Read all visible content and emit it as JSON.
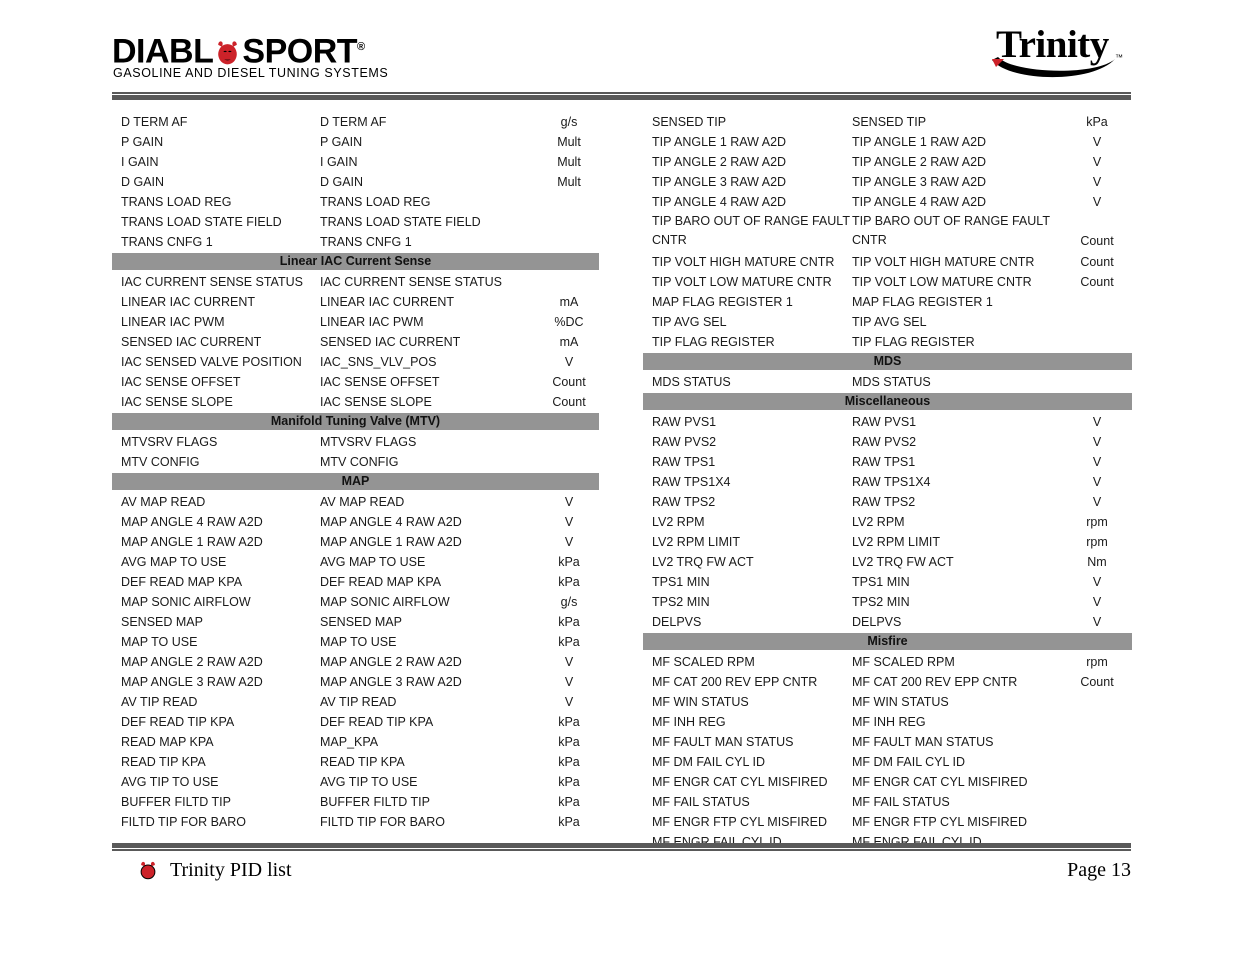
{
  "header": {
    "brand_logo": {
      "wordmark_pre": "DIABL",
      "wordmark_post": "SPORT",
      "registered_mark": "®",
      "tagline": "GASOLINE AND DIESEL TUNING SYSTEMS"
    },
    "product_logo": {
      "name": "Trinity",
      "trademark": "™"
    }
  },
  "footer": {
    "title": "Trinity PID list",
    "page_label": "Page 13"
  },
  "colors": {
    "section_band": "#949494",
    "rule": "#595959",
    "devil_red": "#cc2229",
    "text": "#1a1a1a"
  },
  "left_column": [
    {
      "type": "row",
      "name": "D TERM AF",
      "alias": "D TERM AF",
      "unit": "g/s"
    },
    {
      "type": "row",
      "name": "P GAIN",
      "alias": "P GAIN",
      "unit": "Mult"
    },
    {
      "type": "row",
      "name": "I GAIN",
      "alias": "I GAIN",
      "unit": "Mult"
    },
    {
      "type": "row",
      "name": "D GAIN",
      "alias": "D GAIN",
      "unit": "Mult"
    },
    {
      "type": "row",
      "name": "TRANS LOAD REG",
      "alias": "TRANS LOAD REG",
      "unit": ""
    },
    {
      "type": "row",
      "name": "TRANS LOAD STATE FIELD",
      "alias": "TRANS LOAD STATE FIELD",
      "unit": ""
    },
    {
      "type": "row",
      "name": "TRANS CNFG 1",
      "alias": "TRANS CNFG 1",
      "unit": ""
    },
    {
      "type": "section",
      "title": "Linear IAC Current Sense"
    },
    {
      "type": "row",
      "name": "IAC CURRENT SENSE STATUS",
      "alias": "IAC CURRENT SENSE STATUS",
      "unit": ""
    },
    {
      "type": "row",
      "name": "LINEAR IAC CURRENT",
      "alias": "LINEAR IAC CURRENT",
      "unit": "mA"
    },
    {
      "type": "row",
      "name": "LINEAR IAC PWM",
      "alias": "LINEAR IAC PWM",
      "unit": "%DC"
    },
    {
      "type": "row",
      "name": "SENSED IAC CURRENT",
      "alias": "SENSED IAC CURRENT",
      "unit": "mA"
    },
    {
      "type": "row",
      "name": "IAC SENSED VALVE POSITION",
      "alias": "IAC_SNS_VLV_POS",
      "unit": "V"
    },
    {
      "type": "row",
      "name": "IAC SENSE OFFSET",
      "alias": "IAC SENSE OFFSET",
      "unit": "Count"
    },
    {
      "type": "row",
      "name": "IAC SENSE SLOPE",
      "alias": "IAC SENSE SLOPE",
      "unit": "Count"
    },
    {
      "type": "section",
      "title": "Manifold Tuning Valve (MTV)"
    },
    {
      "type": "row",
      "name": "MTVSRV FLAGS",
      "alias": "MTVSRV FLAGS",
      "unit": ""
    },
    {
      "type": "row",
      "name": "MTV CONFIG",
      "alias": "MTV CONFIG",
      "unit": ""
    },
    {
      "type": "section",
      "title": "MAP"
    },
    {
      "type": "row",
      "name": "AV MAP READ",
      "alias": "AV MAP READ",
      "unit": "V"
    },
    {
      "type": "row",
      "name": "MAP ANGLE 4 RAW A2D",
      "alias": "MAP ANGLE 4 RAW A2D",
      "unit": "V"
    },
    {
      "type": "row",
      "name": "MAP ANGLE 1 RAW A2D",
      "alias": "MAP ANGLE 1 RAW A2D",
      "unit": "V"
    },
    {
      "type": "row",
      "name": "AVG MAP TO USE",
      "alias": "AVG MAP TO USE",
      "unit": "kPa"
    },
    {
      "type": "row",
      "name": "DEF READ MAP KPA",
      "alias": "DEF READ MAP KPA",
      "unit": "kPa"
    },
    {
      "type": "row",
      "name": "MAP SONIC AIRFLOW",
      "alias": "MAP SONIC AIRFLOW",
      "unit": "g/s"
    },
    {
      "type": "row",
      "name": "SENSED MAP",
      "alias": "SENSED MAP",
      "unit": "kPa"
    },
    {
      "type": "row",
      "name": "MAP TO USE",
      "alias": "MAP TO USE",
      "unit": "kPa"
    },
    {
      "type": "row",
      "name": "MAP ANGLE 2 RAW A2D",
      "alias": "MAP ANGLE 2 RAW A2D",
      "unit": "V"
    },
    {
      "type": "row",
      "name": "MAP ANGLE 3 RAW A2D",
      "alias": "MAP ANGLE 3 RAW A2D",
      "unit": "V"
    },
    {
      "type": "row",
      "name": "AV TIP READ",
      "alias": "AV TIP READ",
      "unit": "V"
    },
    {
      "type": "row",
      "name": "DEF READ TIP KPA",
      "alias": "DEF READ TIP KPA",
      "unit": "kPa"
    },
    {
      "type": "row",
      "name": "READ MAP KPA",
      "alias": "MAP_KPA",
      "unit": "kPa"
    },
    {
      "type": "row",
      "name": "READ TIP KPA",
      "alias": "READ TIP KPA",
      "unit": "kPa"
    },
    {
      "type": "row",
      "name": "AVG TIP TO USE",
      "alias": "AVG TIP TO USE",
      "unit": "kPa"
    },
    {
      "type": "row",
      "name": "BUFFER FILTD TIP",
      "alias": "BUFFER FILTD TIP",
      "unit": "kPa"
    },
    {
      "type": "row",
      "name": "FILTD TIP FOR BARO",
      "alias": "FILTD TIP FOR BARO",
      "unit": "kPa"
    }
  ],
  "right_column": [
    {
      "type": "row",
      "name": "SENSED TIP",
      "alias": "SENSED TIP",
      "unit": "kPa"
    },
    {
      "type": "row",
      "name": "TIP ANGLE 1 RAW A2D",
      "alias": "TIP ANGLE 1 RAW A2D",
      "unit": "V"
    },
    {
      "type": "row",
      "name": "TIP ANGLE 2 RAW A2D",
      "alias": "TIP ANGLE 2 RAW A2D",
      "unit": "V"
    },
    {
      "type": "row",
      "name": "TIP ANGLE 3 RAW A2D",
      "alias": "TIP ANGLE 3 RAW A2D",
      "unit": "V"
    },
    {
      "type": "row",
      "name": "TIP ANGLE 4 RAW A2D",
      "alias": "TIP ANGLE 4 RAW A2D",
      "unit": "V"
    },
    {
      "type": "row2",
      "name": "TIP BARO OUT OF RANGE FAULT\nCNTR",
      "alias": "TIP BARO OUT OF RANGE FAULT\nCNTR",
      "unit": "Count"
    },
    {
      "type": "row",
      "name": "TIP VOLT HIGH MATURE CNTR",
      "alias": "TIP VOLT HIGH MATURE CNTR",
      "unit": "Count"
    },
    {
      "type": "row",
      "name": "TIP VOLT LOW MATURE CNTR",
      "alias": "TIP VOLT LOW MATURE CNTR",
      "unit": "Count"
    },
    {
      "type": "row",
      "name": "MAP FLAG REGISTER 1",
      "alias": "MAP FLAG REGISTER 1",
      "unit": ""
    },
    {
      "type": "row",
      "name": "TIP AVG SEL",
      "alias": "TIP AVG SEL",
      "unit": ""
    },
    {
      "type": "row",
      "name": "TIP FLAG REGISTER",
      "alias": "TIP FLAG REGISTER",
      "unit": ""
    },
    {
      "type": "section",
      "title": "MDS"
    },
    {
      "type": "row",
      "name": "MDS STATUS",
      "alias": "MDS STATUS",
      "unit": ""
    },
    {
      "type": "section",
      "title": "Miscellaneous"
    },
    {
      "type": "row",
      "name": "RAW PVS1",
      "alias": "RAW PVS1",
      "unit": "V"
    },
    {
      "type": "row",
      "name": "RAW PVS2",
      "alias": "RAW PVS2",
      "unit": "V"
    },
    {
      "type": "row",
      "name": "RAW TPS1",
      "alias": "RAW TPS1",
      "unit": "V"
    },
    {
      "type": "row",
      "name": "RAW TPS1X4",
      "alias": "RAW TPS1X4",
      "unit": "V"
    },
    {
      "type": "row",
      "name": "RAW TPS2",
      "alias": "RAW TPS2",
      "unit": "V"
    },
    {
      "type": "row",
      "name": "LV2 RPM",
      "alias": "LV2 RPM",
      "unit": "rpm"
    },
    {
      "type": "row",
      "name": "LV2 RPM LIMIT",
      "alias": "LV2 RPM LIMIT",
      "unit": "rpm"
    },
    {
      "type": "row",
      "name": "LV2 TRQ FW ACT",
      "alias": "LV2 TRQ FW ACT",
      "unit": "Nm"
    },
    {
      "type": "row",
      "name": "TPS1 MIN",
      "alias": "TPS1 MIN",
      "unit": "V"
    },
    {
      "type": "row",
      "name": "TPS2 MIN",
      "alias": "TPS2 MIN",
      "unit": "V"
    },
    {
      "type": "row",
      "name": "DELPVS",
      "alias": "DELPVS",
      "unit": "V"
    },
    {
      "type": "section",
      "title": "Misfire"
    },
    {
      "type": "row",
      "name": "MF SCALED RPM",
      "alias": "MF SCALED RPM",
      "unit": "rpm"
    },
    {
      "type": "row",
      "name": "MF CAT 200 REV EPP CNTR",
      "alias": "MF CAT 200 REV EPP CNTR",
      "unit": "Count"
    },
    {
      "type": "row",
      "name": "MF WIN STATUS",
      "alias": "MF WIN STATUS",
      "unit": ""
    },
    {
      "type": "row",
      "name": "MF INH REG",
      "alias": "MF INH REG",
      "unit": ""
    },
    {
      "type": "row",
      "name": "MF FAULT MAN STATUS",
      "alias": "MF FAULT MAN STATUS",
      "unit": ""
    },
    {
      "type": "row",
      "name": "MF DM FAIL CYL ID",
      "alias": "MF DM FAIL CYL ID",
      "unit": ""
    },
    {
      "type": "row",
      "name": "MF ENGR CAT CYL MISFIRED",
      "alias": "MF ENGR CAT CYL MISFIRED",
      "unit": ""
    },
    {
      "type": "row",
      "name": "MF FAIL STATUS",
      "alias": "MF FAIL STATUS",
      "unit": ""
    },
    {
      "type": "row",
      "name": "MF ENGR FTP CYL MISFIRED",
      "alias": "MF ENGR FTP CYL MISFIRED",
      "unit": ""
    },
    {
      "type": "row",
      "name": "MF ENGR FAIL CYL ID",
      "alias": "MF ENGR FAIL CYL ID",
      "unit": ""
    }
  ]
}
